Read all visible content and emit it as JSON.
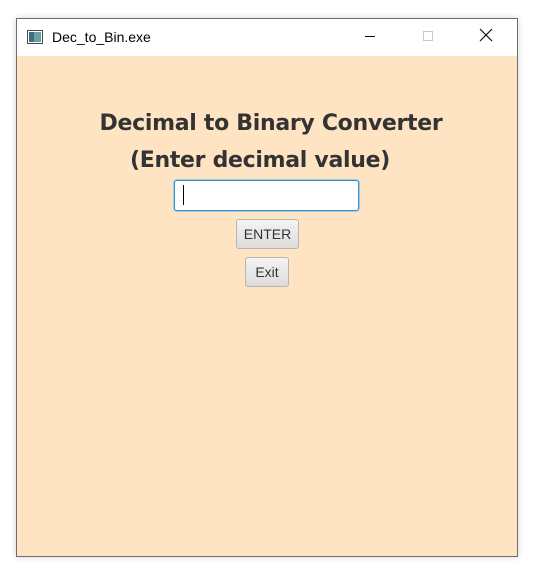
{
  "window": {
    "title": "Dec_to_Bin.exe",
    "icon": "app-window-icon",
    "controls": {
      "minimize_icon": "minimize-icon",
      "maximize_icon": "maximize-icon",
      "close_icon": "close-icon"
    }
  },
  "colors": {
    "background": "#ffe4c4",
    "heading_text": "#333333",
    "input_focus_border": "#3a8fc7"
  },
  "main": {
    "heading_line1": "Decimal to Binary Converter",
    "heading_line2": "(Enter decimal value)",
    "decimal_input": {
      "value": "",
      "placeholder": ""
    },
    "enter_button_label": "ENTER",
    "exit_button_label": "Exit"
  }
}
